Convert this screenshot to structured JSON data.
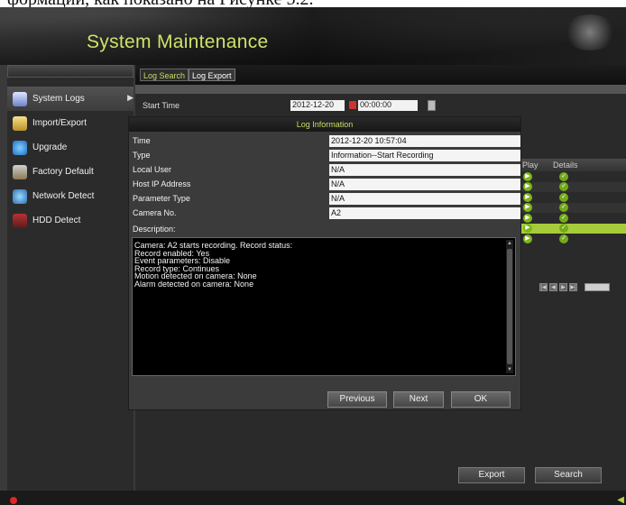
{
  "caption": "формации, как показано на Рисунке 5.2.",
  "header": {
    "title": "System Maintenance"
  },
  "sidebar": {
    "items": [
      {
        "label": "System Logs",
        "icon": "system-logs-icon"
      },
      {
        "label": "Import/Export",
        "icon": "import-export-icon"
      },
      {
        "label": "Upgrade",
        "icon": "upgrade-icon"
      },
      {
        "label": "Factory Default",
        "icon": "factory-default-icon"
      },
      {
        "label": "Network Detect",
        "icon": "network-detect-icon"
      },
      {
        "label": "HDD Detect",
        "icon": "hdd-detect-icon"
      }
    ]
  },
  "tabs": [
    {
      "label": "Log Search"
    },
    {
      "label": "Log Export"
    }
  ],
  "search": {
    "start_time_label": "Start Time",
    "start_date": "2012-12-20",
    "start_time": "00:00:00"
  },
  "results": {
    "col_play": "Play",
    "col_details": "Details"
  },
  "dialog": {
    "title": "Log Information",
    "fields": [
      {
        "label": "Time",
        "value": "2012-12-20 10:57:04"
      },
      {
        "label": "Type",
        "value": "Information--Start Recording"
      },
      {
        "label": "Local User",
        "value": "N/A"
      },
      {
        "label": "Host IP Address",
        "value": "N/A"
      },
      {
        "label": "Parameter Type",
        "value": "N/A"
      },
      {
        "label": "Camera No.",
        "value": "A2"
      }
    ],
    "description_label": "Description:",
    "description_lines": [
      "Camera: A2 starts recording. Record status:",
      "Record enabled: Yes",
      "Event parameters: Disable",
      "Record type: Continues",
      "Motion detected on camera: None",
      "Alarm detected on camera: None"
    ],
    "buttons": {
      "previous": "Previous",
      "next": "Next",
      "ok": "OK"
    }
  },
  "footer_buttons": {
    "export": "Export",
    "search": "Search"
  },
  "colors": {
    "accent": "#c9dd62",
    "selected_row": "#a7cc3a",
    "record_dot": "#e0281e"
  }
}
